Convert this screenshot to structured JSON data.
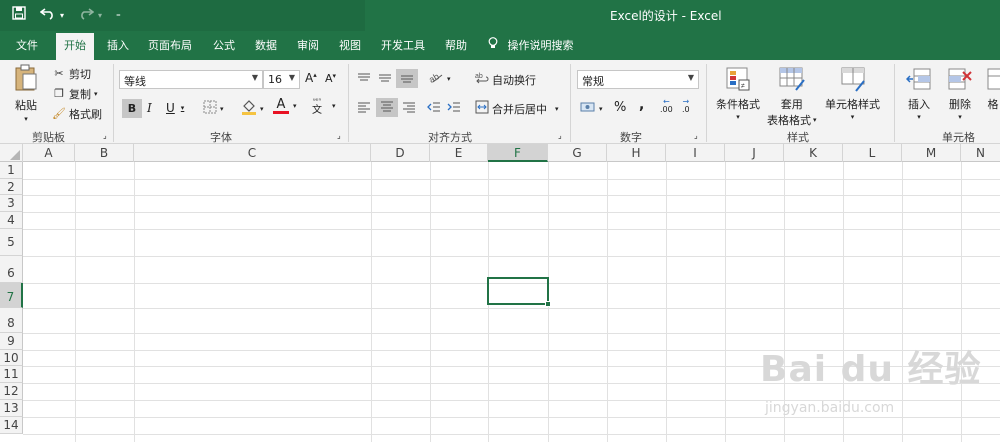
{
  "titlebar": {
    "title": "Excel的设计  -  Excel",
    "qat_icons": [
      "save-icon",
      "undo-icon",
      "undo-dropdown-icon",
      "redo-icon",
      "redo-dropdown-icon",
      "customize-qat-icon"
    ]
  },
  "menu": {
    "tabs": [
      "文件",
      "开始",
      "插入",
      "页面布局",
      "公式",
      "数据",
      "审阅",
      "视图",
      "开发工具",
      "帮助"
    ],
    "active": "开始",
    "tell_me": "操作说明搜索"
  },
  "ribbon": {
    "clipboard": {
      "paste": "粘贴",
      "cut": "剪切",
      "copy": "复制",
      "format_painter": "格式刷",
      "label": "剪贴板"
    },
    "font": {
      "name": "等线",
      "size": "16",
      "bold": "B",
      "italic": "I",
      "underline": "U",
      "grow": "A",
      "shrink": "A",
      "color": "A",
      "phonetic": "文",
      "label": "字体"
    },
    "alignment": {
      "wrap": "自动换行",
      "merge": "合并后居中",
      "label": "对齐方式"
    },
    "number": {
      "format": "常规",
      "percent": "%",
      "comma": ",",
      "inc": ".00",
      "dec": ".0",
      "label": "数字"
    },
    "styles": {
      "conditional": "条件格式",
      "table_line1": "套用",
      "table_line2": "表格格式",
      "cell": "单元格样式",
      "label": "样式"
    },
    "cells": {
      "insert": "插入",
      "delete": "删除",
      "format": "格",
      "label": "单元格"
    }
  },
  "sheet": {
    "columns": [
      "A",
      "B",
      "C",
      "D",
      "E",
      "F",
      "G",
      "H",
      "I",
      "J",
      "K",
      "L",
      "M",
      "N"
    ],
    "rows": [
      "1",
      "2",
      "3",
      "4",
      "5",
      "6",
      "7",
      "8",
      "9",
      "10",
      "11",
      "12",
      "13",
      "14"
    ],
    "selected_column": "F",
    "selected_row": "7"
  },
  "watermark": {
    "main": "Bai du 经验",
    "sub": "jingyan.baidu.com"
  }
}
